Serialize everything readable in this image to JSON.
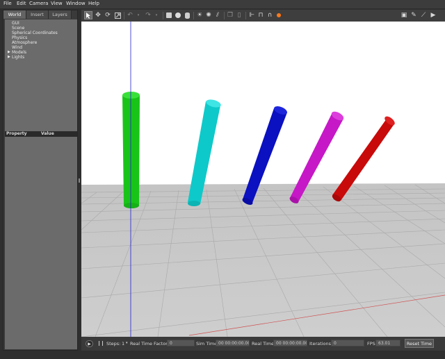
{
  "menu": [
    "File",
    "Edit",
    "Camera",
    "View",
    "Window",
    "Help"
  ],
  "tabs": [
    "World",
    "Insert",
    "Layers"
  ],
  "tree": [
    {
      "label": "GUI",
      "expandable": false
    },
    {
      "label": "Scene",
      "expandable": false
    },
    {
      "label": "Spherical Coordinates",
      "expandable": false
    },
    {
      "label": "Physics",
      "expandable": false
    },
    {
      "label": "Atmosphere",
      "expandable": false
    },
    {
      "label": "Wind",
      "expandable": false
    },
    {
      "label": "Models",
      "expandable": true
    },
    {
      "label": "Lights",
      "expandable": true
    }
  ],
  "properties": {
    "col_property": "Property",
    "col_value": "Value"
  },
  "toolbar_icons": [
    "select-arrow-icon",
    "translate-icon",
    "rotate-icon",
    "scale-icon",
    "undo-icon",
    "undo-dropdown-icon",
    "redo-icon",
    "redo-dropdown-icon",
    "box-shape-icon",
    "sphere-shape-icon",
    "cylinder-shape-icon",
    "point-light-icon",
    "spot-light-icon",
    "directional-light-icon",
    "copy-icon",
    "paste-icon",
    "align-icon",
    "snap-icon",
    "magnet-icon",
    "color-orange-icon",
    "screenshot-icon",
    "log-icon",
    "plot-icon",
    "video-icon"
  ],
  "bottom": {
    "steps_label": "Steps:",
    "steps_value": "1",
    "rtf_label": "Real Time Factor:",
    "rtf_value": "0",
    "sim_label": "Sim Time:",
    "sim_value": "00 00:00:00.000",
    "real_label": "Real Time:",
    "real_value": "00 00:00:00.000",
    "iter_label": "Iterations:",
    "iter_value": "0",
    "fps_label": "FPS:",
    "fps_value": "63.01",
    "reset_label": "Reset Time"
  },
  "colors": {
    "green": "#1fce1f",
    "cyan": "#12cfcf",
    "blue": "#0a12c4",
    "magenta": "#c81ac8",
    "red": "#c80a0a",
    "ground": "#c8c8c8",
    "sky": "#ffffff"
  }
}
